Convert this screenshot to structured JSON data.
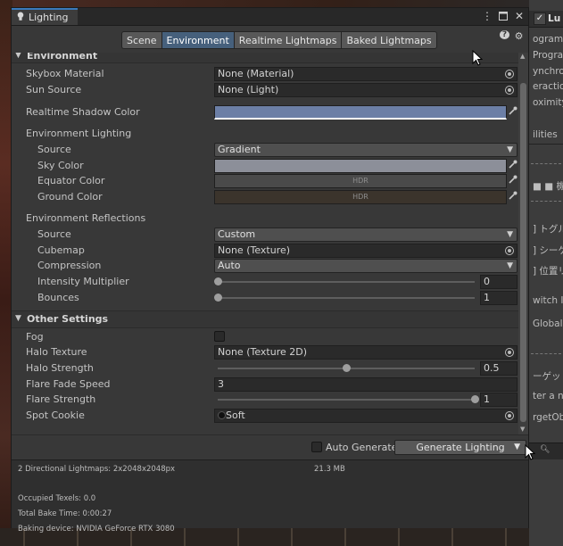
{
  "window": {
    "tab_title": "Lighting",
    "tabs": [
      "Scene",
      "Environment",
      "Realtime Lightmaps",
      "Baked Lightmaps"
    ],
    "active_tab": "Environment"
  },
  "environment": {
    "header": "Environment",
    "skybox_material": {
      "label": "Skybox Material",
      "value": "None (Material)"
    },
    "sun_source": {
      "label": "Sun Source",
      "value": "None (Light)"
    },
    "realtime_shadow_color": {
      "label": "Realtime Shadow Color",
      "color": "#6c7fa6"
    },
    "lighting": {
      "header": "Environment Lighting",
      "source": {
        "label": "Source",
        "value": "Gradient"
      },
      "sky_color": {
        "label": "Sky Color",
        "color": "#8c8f99"
      },
      "equator_color": {
        "label": "Equator Color",
        "color": "#4a4a4a",
        "hdr": "HDR"
      },
      "ground_color": {
        "label": "Ground Color",
        "color": "#3b342c",
        "hdr": "HDR"
      }
    },
    "reflections": {
      "header": "Environment Reflections",
      "source": {
        "label": "Source",
        "value": "Custom"
      },
      "cubemap": {
        "label": "Cubemap",
        "value": "None (Texture)"
      },
      "compression": {
        "label": "Compression",
        "value": "Auto"
      },
      "intensity_multiplier": {
        "label": "Intensity Multiplier",
        "value": "0",
        "fraction": 0
      },
      "bounces": {
        "label": "Bounces",
        "value": "1",
        "fraction": 0
      }
    }
  },
  "other_settings": {
    "header": "Other Settings",
    "fog": {
      "label": "Fog",
      "checked": false
    },
    "halo_texture": {
      "label": "Halo Texture",
      "value": "None (Texture 2D)"
    },
    "halo_strength": {
      "label": "Halo Strength",
      "value": "0.5",
      "fraction": 0.5
    },
    "flare_fade_speed": {
      "label": "Flare Fade Speed",
      "value": "3"
    },
    "flare_strength": {
      "label": "Flare Strength",
      "value": "1",
      "fraction": 1
    },
    "spot_cookie": {
      "label": "Spot Cookie",
      "value": "Soft"
    }
  },
  "footer": {
    "auto_generate": "Auto Generate",
    "generate_button": "Generate Lighting",
    "lightmaps": "2 Directional Lightmaps: 2x2048x2048px",
    "size": "21.3 MB",
    "occupied_texels": "Occupied Texels: 0.0",
    "total_bake_time": "Total Bake Time: 0:00:27",
    "baking_device": "Baking device: NVIDIA GeForce RTX 3080"
  },
  "right_panel": {
    "items": [
      "Lu",
      "ogram",
      "Progra",
      "ynchro",
      "eractio",
      "oximity",
      "ilities",
      "■ ■  機",
      "] トグルス",
      "] シーケ",
      "] 位置リ",
      "witch ID",
      "Global",
      "ーゲット",
      "ter a n",
      "rgetOb"
    ]
  },
  "icons": {
    "bulb": "lightbulb-icon",
    "menu": "kebab-menu-icon",
    "maximize": "maximize-icon",
    "close": "close-icon",
    "help": "help-icon",
    "settings": "gear-icon",
    "eyedropper": "eyedropper-icon",
    "object_picker": "object-picker-icon",
    "search": "search-icon"
  }
}
